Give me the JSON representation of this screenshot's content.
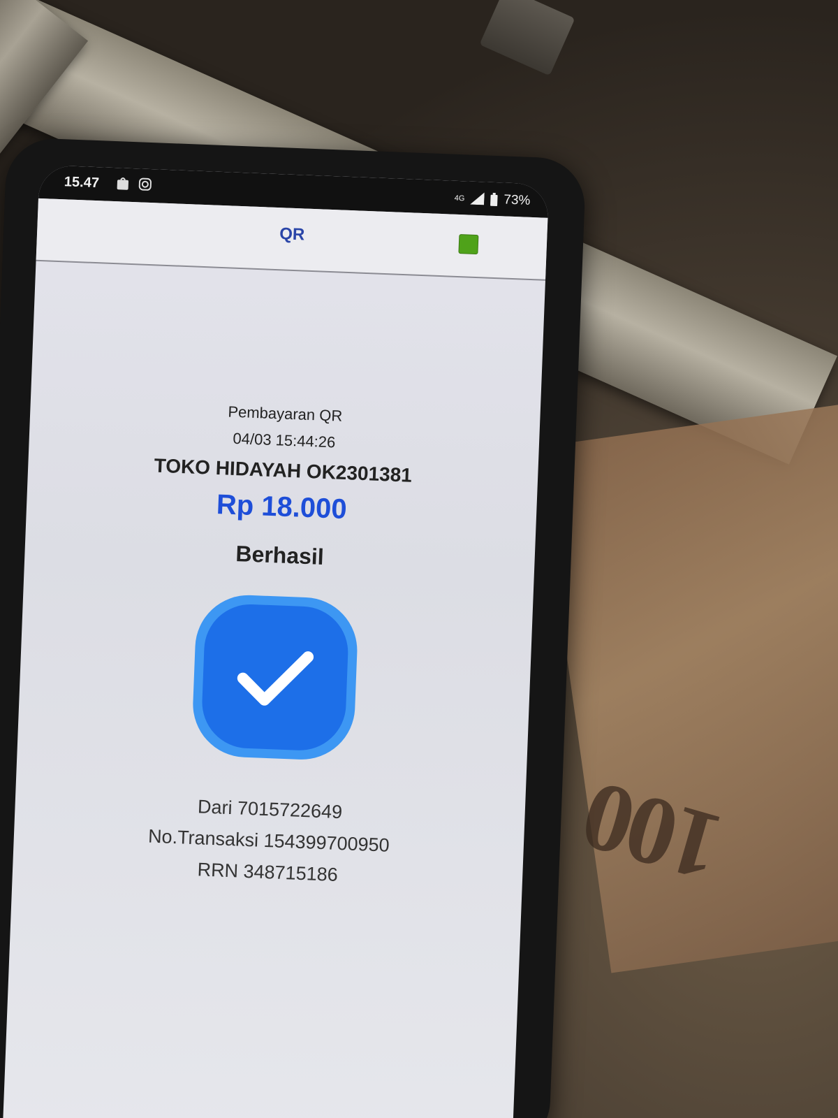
{
  "status_bar": {
    "time": "15.47",
    "battery": "73%",
    "network": "4G"
  },
  "app_bar": {
    "title": "QR",
    "indicator_color": "#4fa21a"
  },
  "receipt": {
    "payment_type": "Pembayaran QR",
    "datetime": "04/03 15:44:26",
    "merchant": "TOKO HIDAYAH OK2301381",
    "amount": "Rp 18.000",
    "status": "Berhasil",
    "from": "Dari 7015722649",
    "transaction_no": "No.Transaksi 154399700950",
    "rrn": "RRN 348715186"
  },
  "background": {
    "banknote_text": "100"
  },
  "colors": {
    "accent_blue": "#1e4ed8",
    "check_blue": "#1d6fe8",
    "title_blue": "#2a45a8"
  }
}
